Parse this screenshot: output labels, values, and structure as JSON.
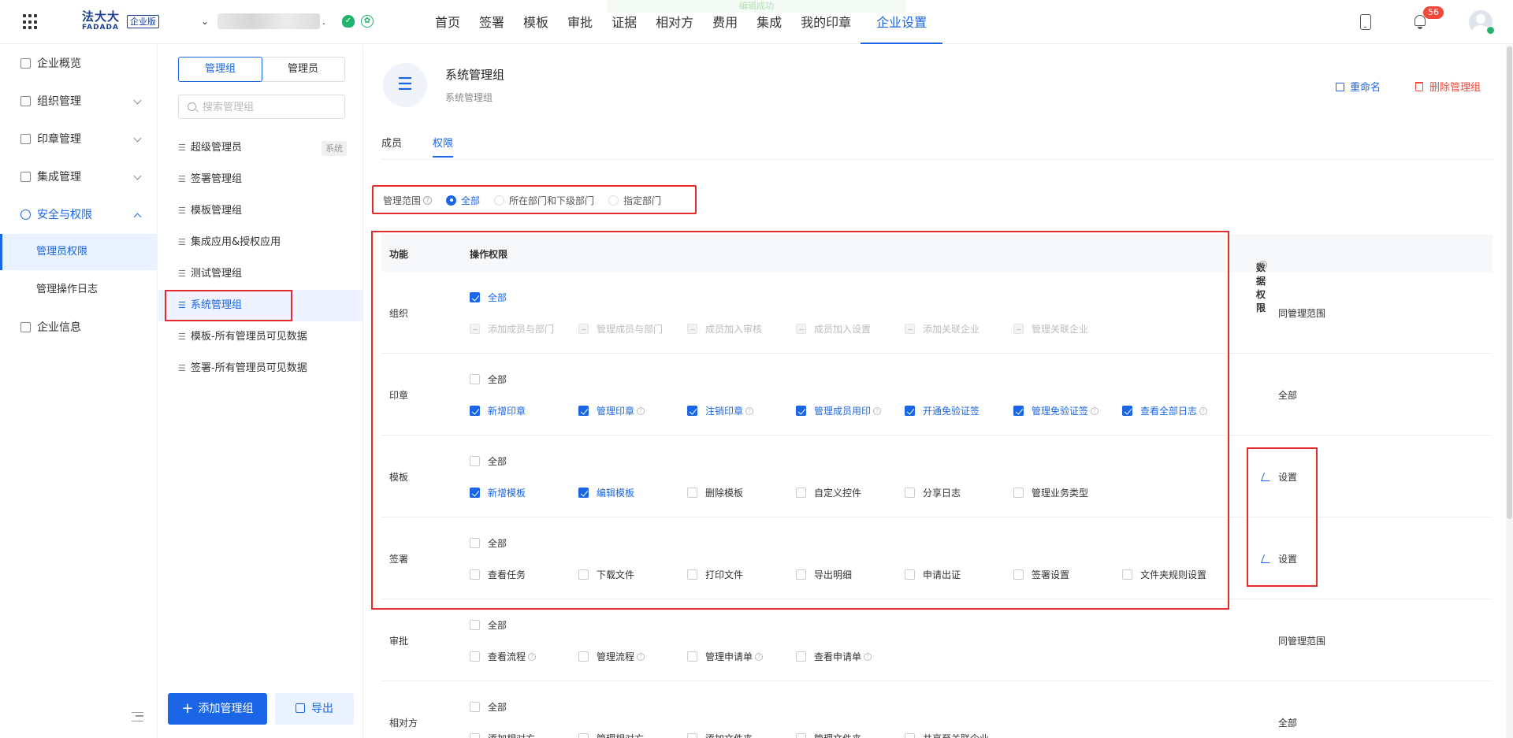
{
  "toast": "编辑成功",
  "topbar": {
    "logo_cn": "法大大",
    "logo_en": "FADADA",
    "logo_badge": "企业版",
    "org_suffix": ".",
    "nav": [
      "首页",
      "签署",
      "模板",
      "审批",
      "证据",
      "相对方",
      "费用",
      "集成",
      "我的印章",
      "企业设置"
    ],
    "active_nav": "企业设置",
    "notification_count": "56"
  },
  "sidebar": {
    "items": [
      "企业概览",
      "组织管理",
      "印章管理",
      "集成管理",
      "安全与权限"
    ],
    "sub_items": [
      "管理员权限",
      "管理操作日志"
    ],
    "bottom_item": "企业信息"
  },
  "groups": {
    "seg_group": "管理组",
    "seg_admin": "管理员",
    "search_placeholder": "搜索管理组",
    "list": [
      "超级管理员",
      "签署管理组",
      "模板管理组",
      "集成应用&授权应用",
      "测试管理组",
      "系统管理组",
      "模板-所有管理员可见数据",
      "签署-所有管理员可见数据"
    ],
    "system_tag": "系统",
    "add_button": "添加管理组",
    "export_button": "导出"
  },
  "main": {
    "title": "系统管理组",
    "subtitle": "系统管理组",
    "rename": "重命名",
    "delete": "删除管理组",
    "tabs": [
      "成员",
      "权限"
    ],
    "scope_label": "管理范围",
    "scope_options": [
      "全部",
      "所在部门和下级部门",
      "指定部门"
    ],
    "table_head": {
      "func": "功能",
      "ops": "操作权限",
      "data": "数据权限"
    },
    "all_label": "全部",
    "rows": [
      {
        "label": "组织",
        "data": "同管理范围",
        "perms": [
          "添加成员与部门",
          "管理成员与部门",
          "成员加入审核",
          "成员加入设置",
          "添加关联企业",
          "管理关联企业"
        ]
      },
      {
        "label": "印章",
        "data": "全部",
        "perms": [
          "新增印章",
          "管理印章",
          "注销印章",
          "管理成员用印",
          "开通免验证签",
          "管理免验证签",
          "查看全部日志"
        ]
      },
      {
        "label": "模板",
        "data": "设置",
        "perms": [
          "新增模板",
          "编辑模板",
          "删除模板",
          "自定义控件",
          "分享日志",
          "管理业务类型"
        ]
      },
      {
        "label": "签署",
        "data": "设置",
        "perms": [
          "查看任务",
          "下载文件",
          "打印文件",
          "导出明细",
          "申请出证",
          "签署设置",
          "文件夹规则设置"
        ]
      },
      {
        "label": "审批",
        "data": "同管理范围",
        "perms": [
          "查看流程",
          "管理流程",
          "管理申请单",
          "查看申请单"
        ]
      },
      {
        "label": "相对方",
        "data": "全部",
        "perms": [
          "添加相对方",
          "管理相对方",
          "添加文件夹",
          "管理文件夹",
          "共享至关联企业"
        ]
      }
    ]
  }
}
